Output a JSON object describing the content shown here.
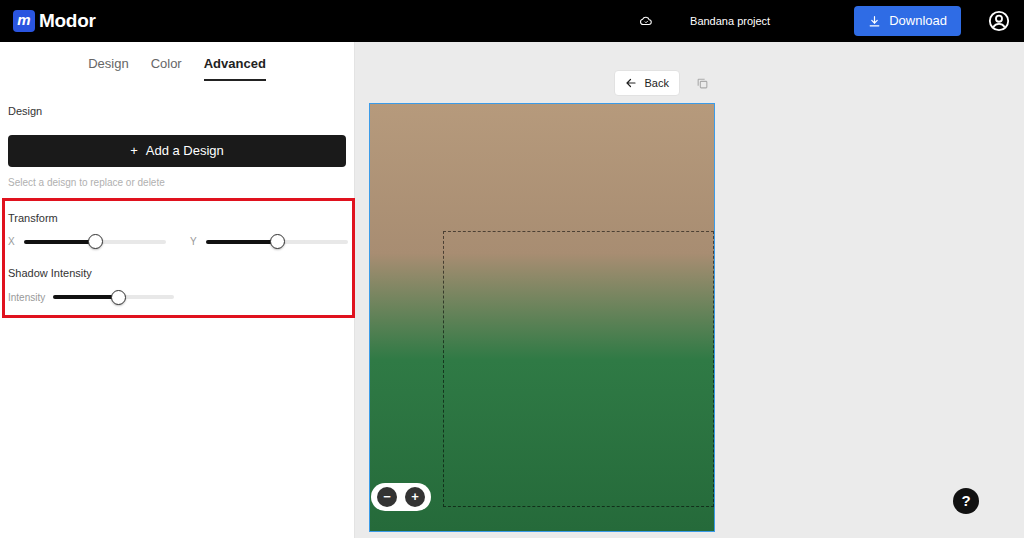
{
  "app": {
    "logo_letter": "m",
    "name": "Modor"
  },
  "project": {
    "title": "Bandana project"
  },
  "download": {
    "label": "Download"
  },
  "tabs": [
    {
      "label": "Design",
      "selected": false
    },
    {
      "label": "Color",
      "selected": false
    },
    {
      "label": "Advanced",
      "selected": true
    }
  ],
  "design": {
    "heading": "Design",
    "add_icon": "+",
    "add_button": "Add a Design",
    "hint": "Select a deisgn to replace or delete"
  },
  "transform": {
    "heading": "Transform",
    "sliders": [
      {
        "label": "X",
        "level": 0.5
      },
      {
        "label": "Y",
        "level": 0.5
      }
    ]
  },
  "shadow": {
    "heading": "Shadow Intensity",
    "sliders": [
      {
        "label": "Intensity",
        "level": 0.54
      }
    ]
  },
  "canvas": {
    "back": "Back",
    "zoom": [
      "−",
      "+"
    ],
    "help": "?"
  }
}
